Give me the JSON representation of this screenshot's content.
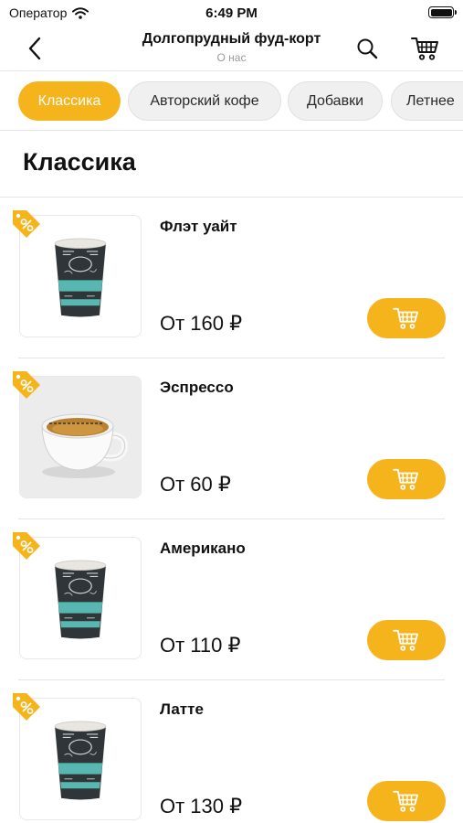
{
  "status_bar": {
    "carrier": "Оператор",
    "time": "6:49 PM"
  },
  "header": {
    "title": "Долгопрудный фуд-корт",
    "subtitle": "О нас"
  },
  "tabs": [
    {
      "label": "Классика",
      "active": true
    },
    {
      "label": "Авторский кофе",
      "active": false
    },
    {
      "label": "Добавки",
      "active": false
    },
    {
      "label": "Летнее",
      "active": false
    }
  ],
  "section": {
    "title": "Классика"
  },
  "products": [
    {
      "name": "Флэт уайт",
      "price": "От 160 ₽",
      "image": "paper-cup-flat-white"
    },
    {
      "name": "Эспрессо",
      "price": "От 60 ₽",
      "image": "ceramic-espresso-cup"
    },
    {
      "name": "Американо",
      "price": "От 110 ₽",
      "image": "paper-cup-americano"
    },
    {
      "name": "Латте",
      "price": "От 130 ₽",
      "image": "paper-cup-latte"
    }
  ],
  "icons": {
    "back": "chevron-left-icon",
    "search": "search-icon",
    "cart": "cart-icon",
    "discount": "percent-tag-icon",
    "add_to_cart": "cart-icon"
  },
  "colors": {
    "accent": "#f5b31c",
    "divider": "#e4e4e4",
    "subtitle": "#9a9a9a"
  }
}
